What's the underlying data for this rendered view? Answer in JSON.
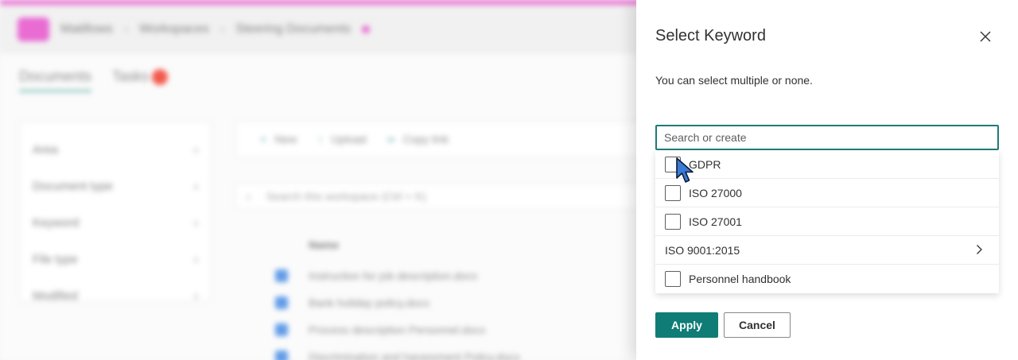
{
  "background": {
    "breadcrumbs": [
      "Matillows",
      "Workspaces",
      "Steering Documents"
    ],
    "tabs": [
      "Documents",
      "Tasks"
    ],
    "filters": [
      "Area",
      "Document type",
      "Keyword",
      "File type",
      "Modified"
    ],
    "toolbar": [
      "New",
      "Upload",
      "Copy link"
    ],
    "search_placeholder": "Search this workspace (Ctrl + K)",
    "column_name": "Name",
    "documents": [
      "Instruction for job description.docx",
      "Bank holiday policy.docx",
      "Process description Personnel.docx",
      "Discrimination and harassment Policy.docx"
    ],
    "colors": {
      "accent_pink": "#e23bc4",
      "accent_teal": "#58a9a2"
    }
  },
  "panel": {
    "title": "Select Keyword",
    "description": "You can select multiple or none.",
    "search_placeholder": "Search or create",
    "search_value": "",
    "options": [
      {
        "label": "GDPR",
        "type": "checkbox",
        "checked": false
      },
      {
        "label": "ISO 27000",
        "type": "checkbox",
        "checked": false
      },
      {
        "label": "ISO 27001",
        "type": "checkbox",
        "checked": false
      },
      {
        "label": "ISO 9001:2015",
        "type": "submenu",
        "icon": "chevron-right-icon"
      },
      {
        "label": "Personnel handbook",
        "type": "checkbox",
        "checked": false
      }
    ],
    "apply_label": "Apply",
    "cancel_label": "Cancel",
    "close_icon": "close-icon",
    "colors": {
      "primary": "#0f7c76",
      "focus_border": "#1c7c78"
    }
  }
}
